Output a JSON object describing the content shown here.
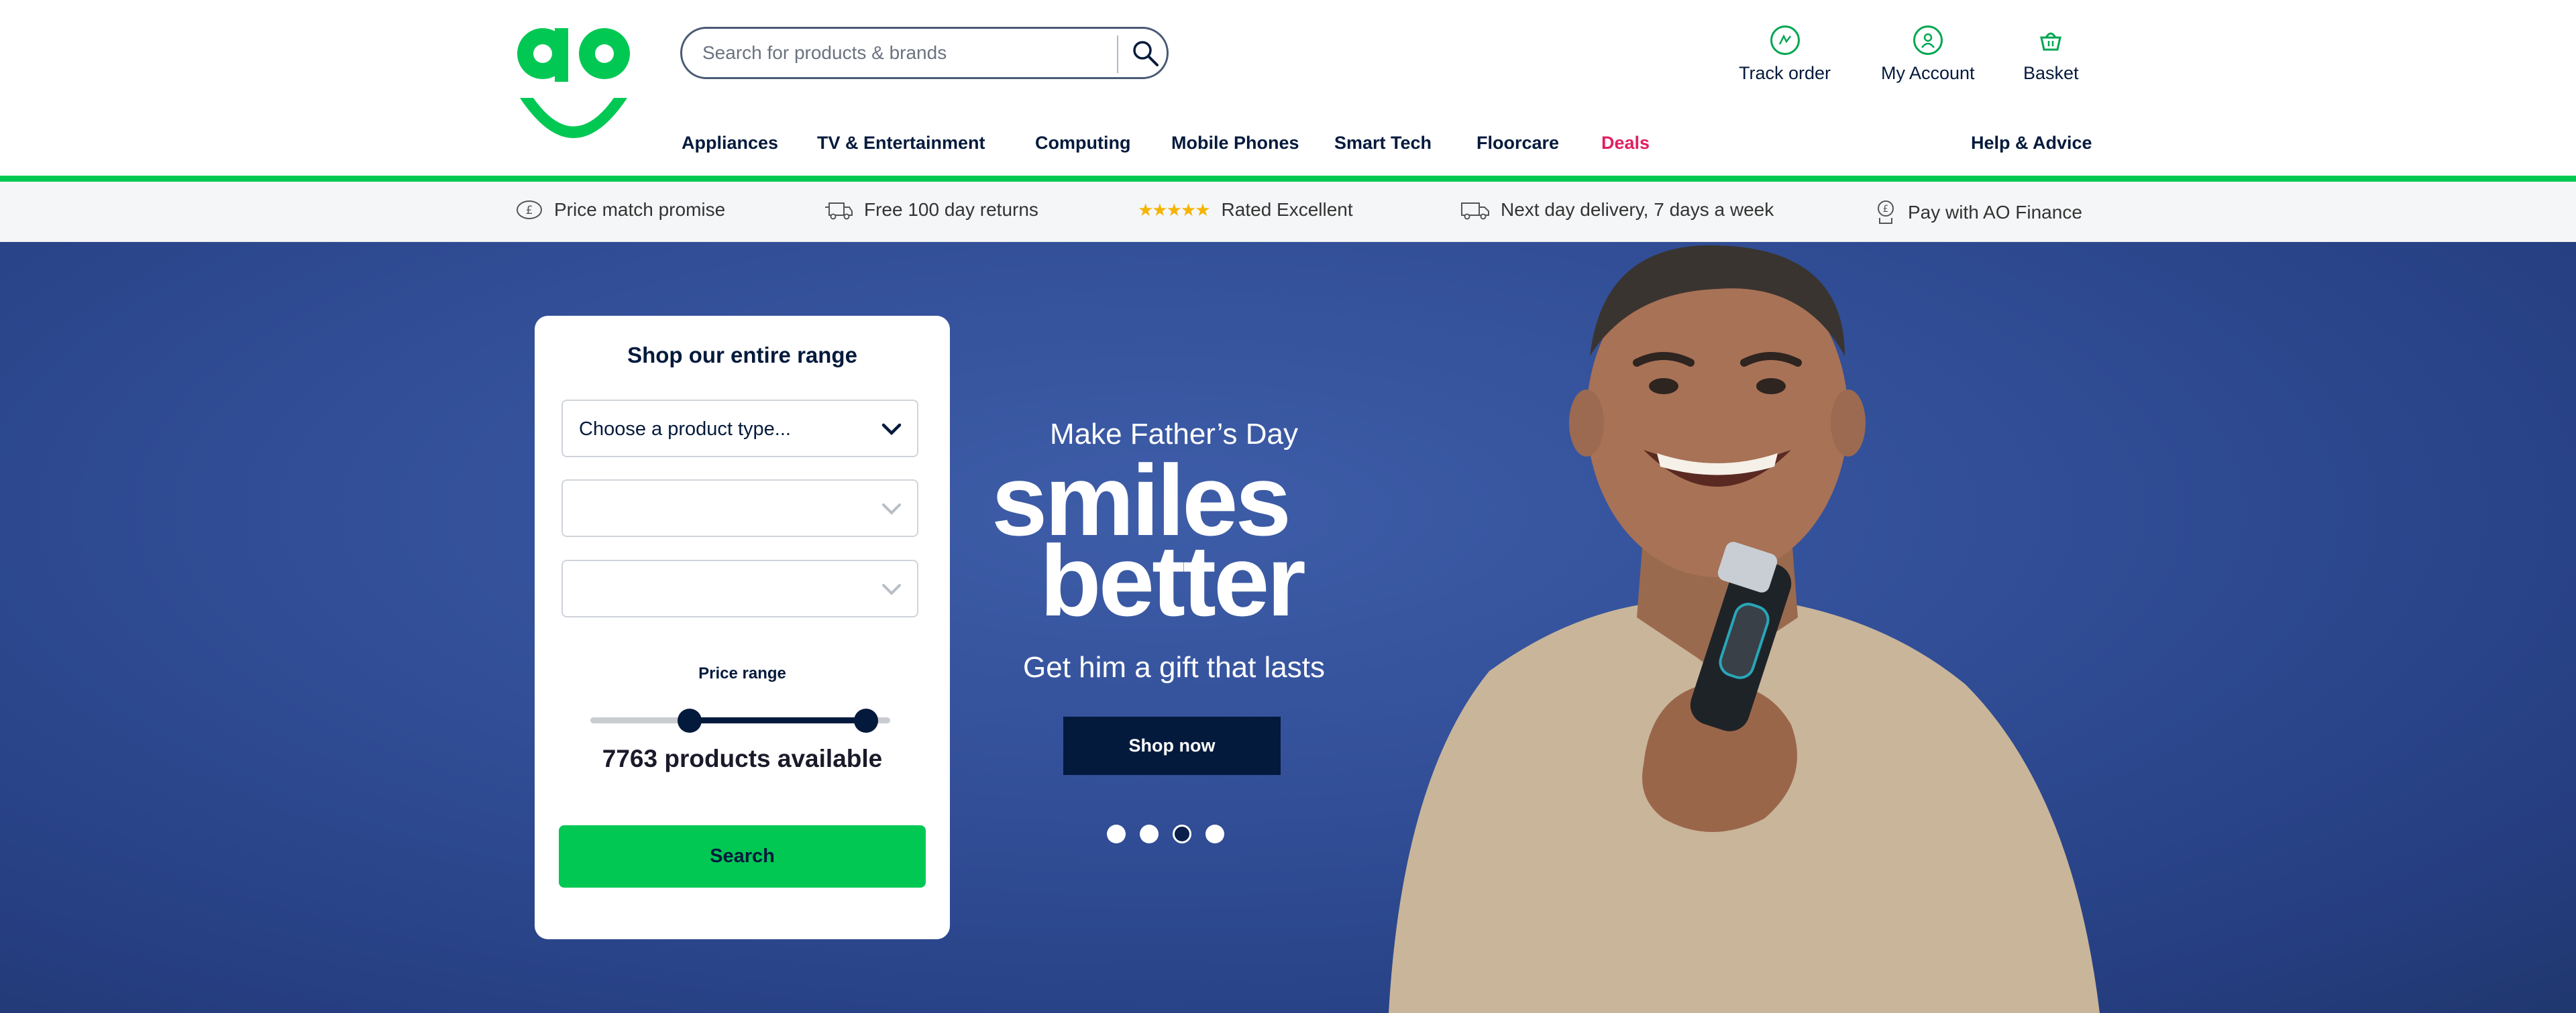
{
  "header": {
    "logo_alt": "ao",
    "search_placeholder": "Search for products & brands",
    "utility": [
      {
        "label": "Track order",
        "icon": "track-order-icon"
      },
      {
        "label": "My Account",
        "icon": "account-icon"
      },
      {
        "label": "Basket",
        "icon": "basket-icon"
      }
    ],
    "nav": [
      {
        "label": "Appliances"
      },
      {
        "label": "TV & Entertainment"
      },
      {
        "label": "Computing"
      },
      {
        "label": "Mobile Phones"
      },
      {
        "label": "Smart Tech"
      },
      {
        "label": "Floorcare"
      },
      {
        "label": "Deals"
      },
      {
        "label": "Help & Advice"
      }
    ]
  },
  "usp": [
    {
      "label": "Price match promise",
      "icon": "pound-coin-icon"
    },
    {
      "label": "Free 100 day returns",
      "icon": "return-van-icon"
    },
    {
      "label": "Rated Excellent",
      "icon": "stars-icon",
      "stars": "★★★★★"
    },
    {
      "label": "Next day delivery, 7 days a week",
      "icon": "delivery-truck-icon"
    },
    {
      "label": "Pay with AO Finance",
      "icon": "finance-icon"
    }
  ],
  "finder": {
    "title": "Shop our entire range",
    "product_type_value": "Choose a product type...",
    "select2_value": "",
    "select3_value": "",
    "price_label": "Price range",
    "price_range_fraction": [
      0.33,
      0.92
    ],
    "count": "7763 products available",
    "search_label": "Search"
  },
  "promo": {
    "line1": "Make Father’s Day",
    "line2": "smiles",
    "line3": "better",
    "line4": "Get him a gift that lasts",
    "cta": "Shop now",
    "slides": 4,
    "active_slide": 3
  },
  "colors": {
    "brand_green": "#00c853",
    "navy": "#041a3c",
    "deals_pink": "#e0205f",
    "hero_blue": "#324f98"
  }
}
